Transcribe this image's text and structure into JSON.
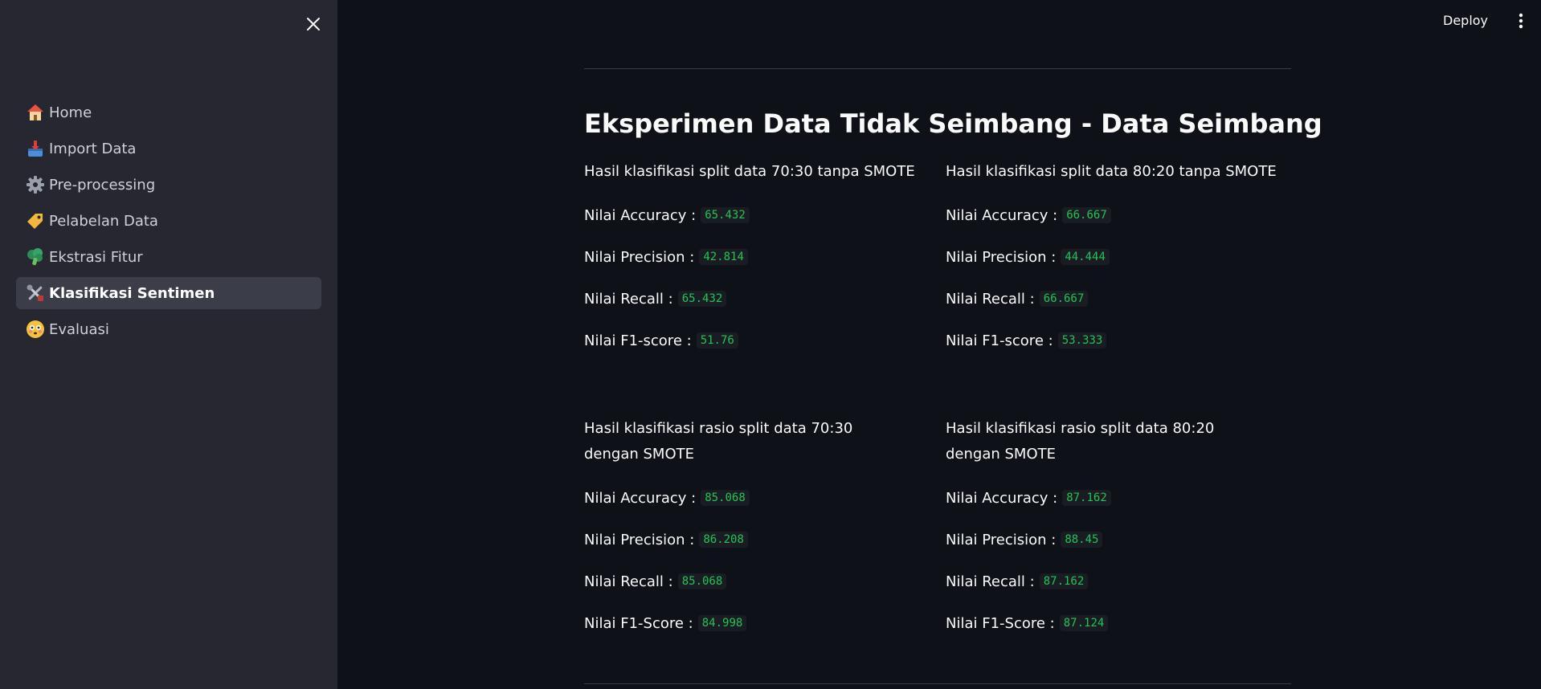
{
  "header": {
    "deploy_label": "Deploy"
  },
  "sidebar": {
    "items": [
      {
        "label": "Home",
        "icon": "house-icon"
      },
      {
        "label": "Import Data",
        "icon": "inbox-tray-icon"
      },
      {
        "label": "Pre-processing",
        "icon": "gear-icon"
      },
      {
        "label": "Pelabelan Data",
        "icon": "label-tag-icon"
      },
      {
        "label": "Ekstrasi Fitur",
        "icon": "broccoli-icon"
      },
      {
        "label": "Klasifikasi Sentimen",
        "icon": "tools-icon",
        "active": true
      },
      {
        "label": "Evaluasi",
        "icon": "flushed-face-icon"
      }
    ]
  },
  "main": {
    "title": "Eksperimen Data Tidak Seimbang - Data Seimbang",
    "results": [
      {
        "title": "Hasil klasifikasi split data 70:30 tanpa SMOTE",
        "metrics": [
          {
            "label": "Nilai Accuracy :",
            "value": "65.432"
          },
          {
            "label": "Nilai Precision :",
            "value": "42.814"
          },
          {
            "label": "Nilai Recall :",
            "value": "65.432"
          },
          {
            "label": "Nilai F1-score :",
            "value": "51.76"
          }
        ]
      },
      {
        "title": "Hasil klasifikasi split data 80:20 tanpa SMOTE",
        "metrics": [
          {
            "label": "Nilai Accuracy :",
            "value": "66.667"
          },
          {
            "label": "Nilai Precision :",
            "value": "44.444"
          },
          {
            "label": "Nilai Recall :",
            "value": "66.667"
          },
          {
            "label": "Nilai F1-score :",
            "value": "53.333"
          }
        ]
      },
      {
        "title": "Hasil klasifikasi rasio split data 70:30 dengan SMOTE",
        "metrics": [
          {
            "label": "Nilai Accuracy :",
            "value": "85.068"
          },
          {
            "label": "Nilai Precision :",
            "value": "86.208"
          },
          {
            "label": "Nilai Recall :",
            "value": "85.068"
          },
          {
            "label": "Nilai F1-Score :",
            "value": "84.998"
          }
        ]
      },
      {
        "title": "Hasil klasifikasi rasio split data 80:20 dengan SMOTE",
        "metrics": [
          {
            "label": "Nilai Accuracy :",
            "value": "87.162"
          },
          {
            "label": "Nilai Precision :",
            "value": "88.45"
          },
          {
            "label": "Nilai Recall :",
            "value": "87.162"
          },
          {
            "label": "Nilai F1-Score :",
            "value": "87.124"
          }
        ]
      }
    ]
  },
  "colors": {
    "background": "#0e1117",
    "sidebar": "#262730",
    "active_item": "#3b3d49",
    "metric_value": "#21c354"
  }
}
